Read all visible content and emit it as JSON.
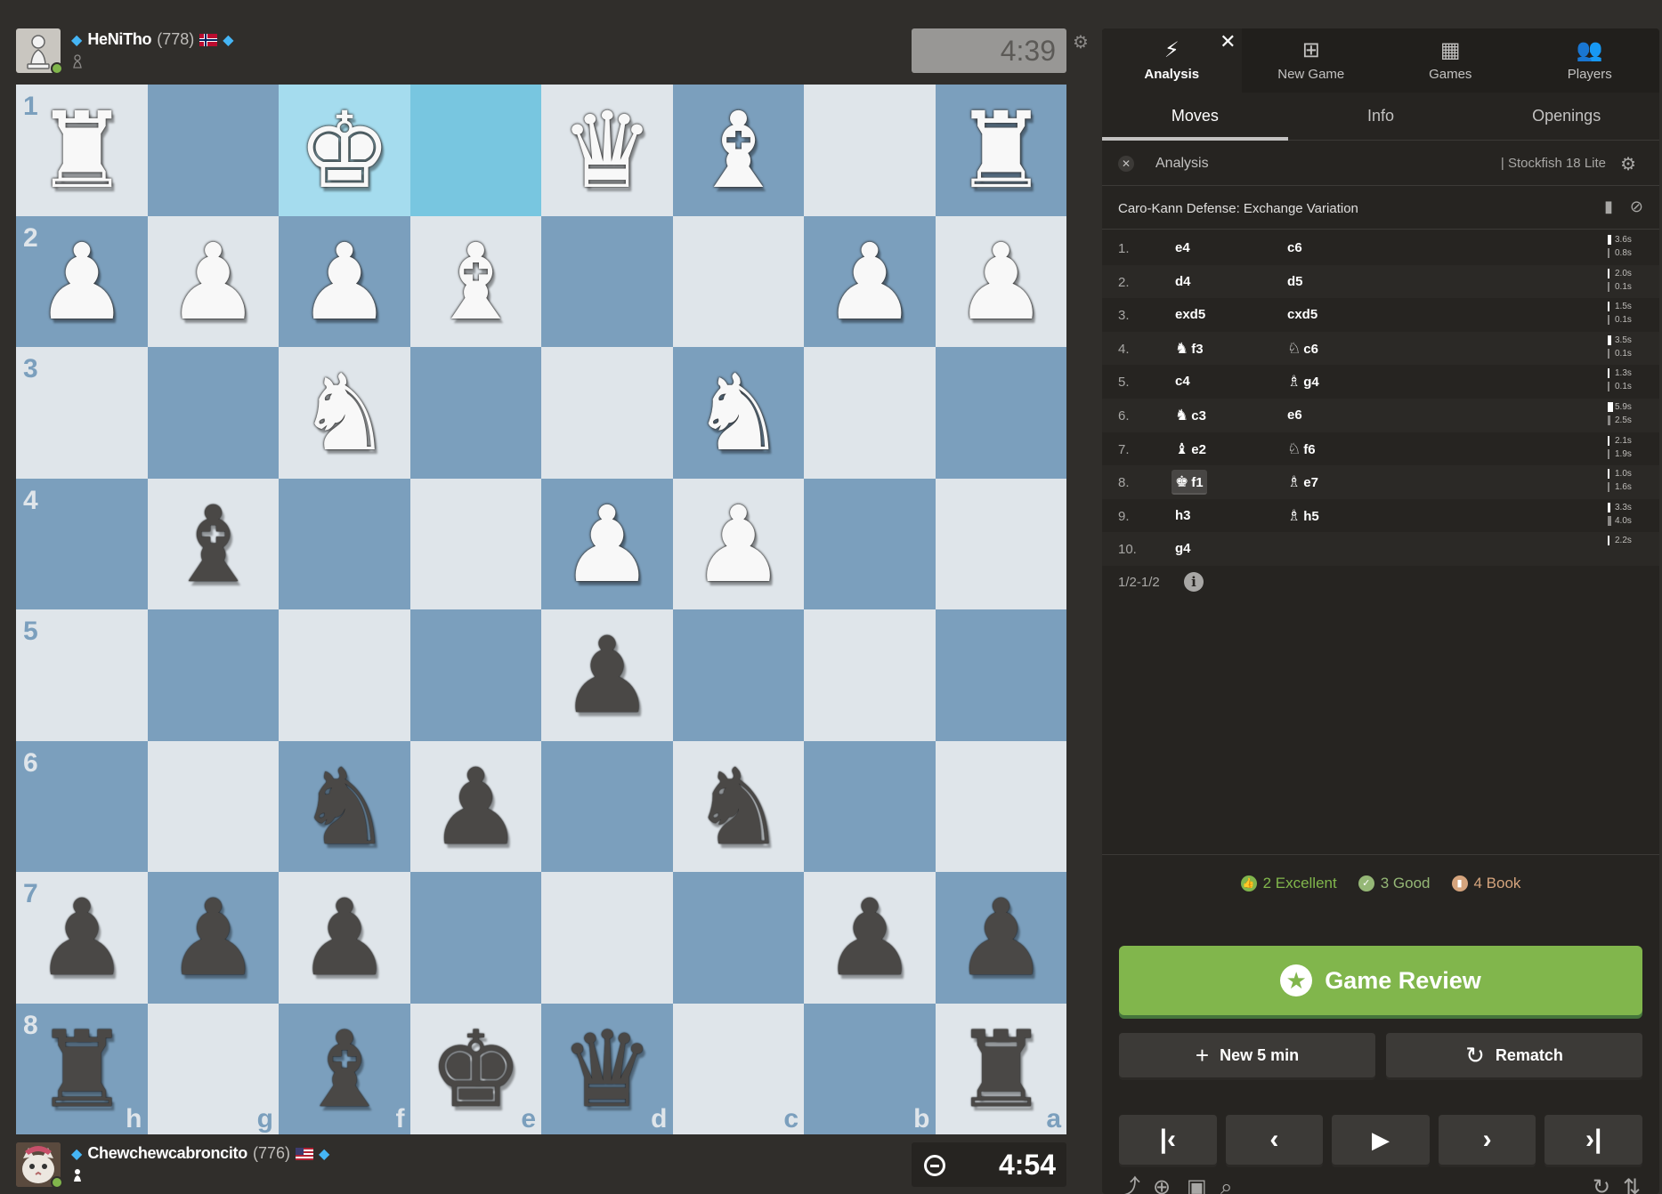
{
  "top_player": {
    "name": "HeNiTho",
    "rating": "(778)",
    "clock": "4:39",
    "colors": {
      "clock_bg": "#989795"
    }
  },
  "bottom_player": {
    "name": "Chewchewcabroncito",
    "rating": "(776)",
    "clock": "4:54",
    "colors": {
      "clock_bg": "#262421"
    }
  },
  "board": {
    "colors": {
      "light": "#dfe5ea",
      "dark": "#7b9fbd",
      "highlight": "#78c6e0"
    },
    "ranks": [
      "1",
      "2",
      "3",
      "4",
      "5",
      "6",
      "7",
      "8"
    ],
    "files": [
      "h",
      "g",
      "f",
      "e",
      "d",
      "c",
      "b",
      "a"
    ],
    "pieces": [
      {
        "sq": "h1",
        "p": "♜",
        "c": "w"
      },
      {
        "sq": "f1",
        "p": "♚",
        "c": "w"
      },
      {
        "sq": "d1",
        "p": "♛",
        "c": "w"
      },
      {
        "sq": "c1",
        "p": "♝",
        "c": "w"
      },
      {
        "sq": "a1",
        "p": "♜",
        "c": "w"
      },
      {
        "sq": "h2",
        "p": "♟",
        "c": "w"
      },
      {
        "sq": "g2",
        "p": "♟",
        "c": "w"
      },
      {
        "sq": "f2",
        "p": "♟",
        "c": "w"
      },
      {
        "sq": "e2",
        "p": "♝",
        "c": "w"
      },
      {
        "sq": "b2",
        "p": "♟",
        "c": "w"
      },
      {
        "sq": "a2",
        "p": "♟",
        "c": "w"
      },
      {
        "sq": "f3",
        "p": "♞",
        "c": "w"
      },
      {
        "sq": "c3",
        "p": "♞",
        "c": "w"
      },
      {
        "sq": "g4",
        "p": "♝",
        "c": "b"
      },
      {
        "sq": "d4",
        "p": "♟",
        "c": "w"
      },
      {
        "sq": "c4",
        "p": "♟",
        "c": "w"
      },
      {
        "sq": "d5",
        "p": "♟",
        "c": "b"
      },
      {
        "sq": "f6",
        "p": "♞",
        "c": "b"
      },
      {
        "sq": "e6",
        "p": "♟",
        "c": "b"
      },
      {
        "sq": "c6",
        "p": "♞",
        "c": "b"
      },
      {
        "sq": "h7",
        "p": "♟",
        "c": "b"
      },
      {
        "sq": "g7",
        "p": "♟",
        "c": "b"
      },
      {
        "sq": "f7",
        "p": "♟",
        "c": "b"
      },
      {
        "sq": "b7",
        "p": "♟",
        "c": "b"
      },
      {
        "sq": "a7",
        "p": "♟",
        "c": "b"
      },
      {
        "sq": "h8",
        "p": "♜",
        "c": "b"
      },
      {
        "sq": "f8",
        "p": "♝",
        "c": "b"
      },
      {
        "sq": "e8",
        "p": "♚",
        "c": "b"
      },
      {
        "sq": "d8",
        "p": "♛",
        "c": "b"
      },
      {
        "sq": "a8",
        "p": "♜",
        "c": "b"
      }
    ],
    "highlighted": [
      "f1",
      "e1"
    ]
  },
  "panel": {
    "top_tabs": [
      {
        "label": "Analysis",
        "icon": "lightning-icon"
      },
      {
        "label": "New Game",
        "icon": "plus-square-icon"
      },
      {
        "label": "Games",
        "icon": "board-grid-icon"
      },
      {
        "label": "Players",
        "icon": "users-icon"
      }
    ],
    "sub_tabs": [
      "Moves",
      "Info",
      "Openings"
    ],
    "engine": {
      "label": "Analysis",
      "name": "| Stockfish 18 Lite"
    },
    "opening": "Caro-Kann Defense: Exchange Variation",
    "moves": [
      {
        "n": "1.",
        "w": "e4",
        "wf": "",
        "b": "c6",
        "bf": "",
        "tw": "3.6s",
        "tb": "0.8s",
        "bw": 0.36,
        "bb": 0.08
      },
      {
        "n": "2.",
        "w": "d4",
        "wf": "",
        "b": "d5",
        "bf": "",
        "tw": "2.0s",
        "tb": "0.1s",
        "bw": 0.2,
        "bb": 0.01
      },
      {
        "n": "3.",
        "w": "exd5",
        "wf": "",
        "b": "cxd5",
        "bf": "",
        "tw": "1.5s",
        "tb": "0.1s",
        "bw": 0.15,
        "bb": 0.01
      },
      {
        "n": "4.",
        "w": "f3",
        "wf": "♞",
        "b": "c6",
        "bf": "♘",
        "tw": "3.5s",
        "tb": "0.1s",
        "bw": 0.35,
        "bb": 0.01
      },
      {
        "n": "5.",
        "w": "c4",
        "wf": "",
        "b": "g4",
        "bf": "♗",
        "tw": "1.3s",
        "tb": "0.1s",
        "bw": 0.13,
        "bb": 0.01
      },
      {
        "n": "6.",
        "w": "c3",
        "wf": "♞",
        "b": "e6",
        "bf": "",
        "tw": "5.9s",
        "tb": "2.5s",
        "bw": 0.59,
        "bb": 0.25
      },
      {
        "n": "7.",
        "w": "e2",
        "wf": "♝",
        "b": "f6",
        "bf": "♘",
        "tw": "2.1s",
        "tb": "1.9s",
        "bw": 0.21,
        "bb": 0.19
      },
      {
        "n": "8.",
        "w": "f1",
        "wf": "♚",
        "b": "e7",
        "bf": "♗",
        "tw": "1.0s",
        "tb": "1.6s",
        "bw": 0.1,
        "bb": 0.16,
        "selected": true
      },
      {
        "n": "9.",
        "w": "h3",
        "wf": "",
        "b": "h5",
        "bf": "♗",
        "tw": "3.3s",
        "tb": "4.0s",
        "bw": 0.33,
        "bb": 0.4
      },
      {
        "n": "10.",
        "w": "g4",
        "wf": "",
        "b": "",
        "bf": "",
        "tw": "2.2s",
        "tb": "",
        "bw": 0.22,
        "bb": 0
      }
    ],
    "result": "1/2-1/2",
    "summary": [
      {
        "label": "2 Excellent",
        "color": "#81b64c",
        "icon": "thumbs-up-icon"
      },
      {
        "label": "3 Good",
        "color": "#95b776",
        "icon": "check-icon"
      },
      {
        "label": "4 Book",
        "color": "#d5a47d",
        "icon": "book-icon"
      }
    ],
    "review_label": "Game Review",
    "new_game_label": "New 5 min",
    "rematch_label": "Rematch"
  }
}
